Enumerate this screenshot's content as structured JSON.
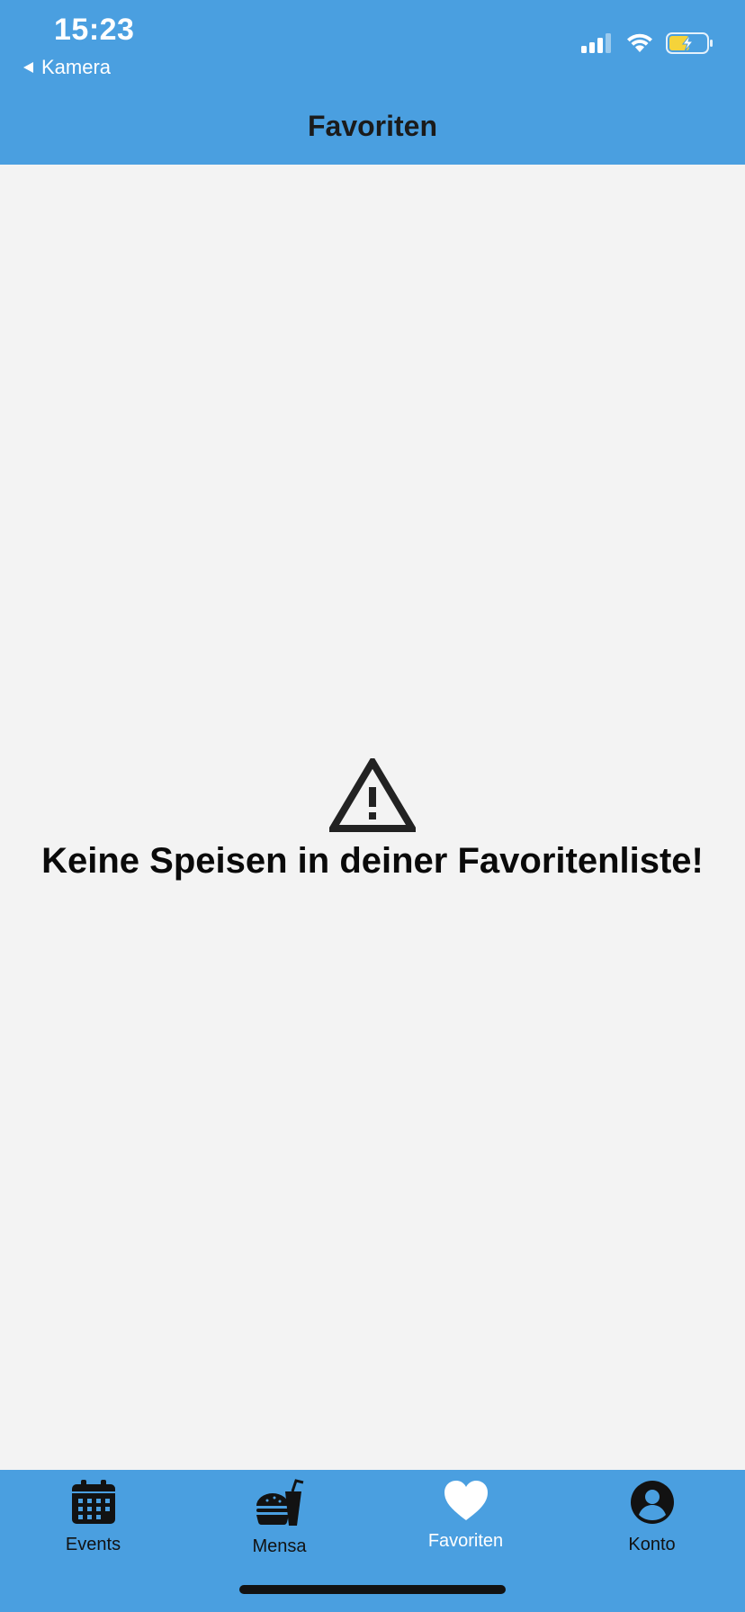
{
  "status_bar": {
    "time": "15:23",
    "back_app": "Kamera"
  },
  "header": {
    "title": "Favoriten"
  },
  "empty_state": {
    "message": "Keine Speisen in deiner Favoritenliste!",
    "icon": "warning-icon"
  },
  "tabs": [
    {
      "label": "Events",
      "icon": "calendar-icon"
    },
    {
      "label": "Mensa",
      "icon": "food-icon"
    },
    {
      "label": "Favoriten",
      "icon": "heart-icon",
      "active": true
    },
    {
      "label": "Konto",
      "icon": "account-icon"
    }
  ],
  "colors": {
    "brand_blue": "#4a9fe0",
    "background": "#f3f3f3",
    "battery_fill": "#f5d33a"
  }
}
